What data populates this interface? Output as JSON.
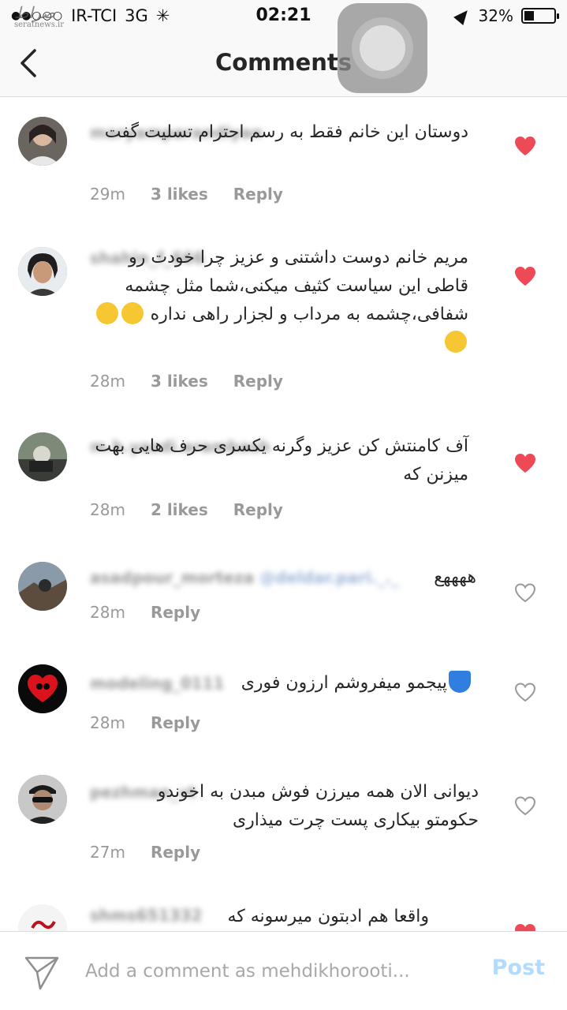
{
  "status_bar": {
    "carrier": "IR-TCI",
    "network": "3G",
    "time": "02:21",
    "battery": "32%",
    "battery_level": 0.32
  },
  "watermark": {
    "logo": "صراط",
    "site": "seratnews.ir"
  },
  "nav": {
    "title": "Comments"
  },
  "comments": [
    {
      "username": "maryamparandiyan",
      "text": "دوستان این خانم فقط به رسم احترام تسلیت گفت",
      "time": "29m",
      "likes": "3 likes",
      "reply": "Reply",
      "liked": true
    },
    {
      "username": "shahin_f_666",
      "text": "مریم خانم دوست داشتنی و عزیز چرا خودت رو قاطی این سیاست کثیف میکنی،شما مثل چشمه شفافی،چشمه به مرداب و لجزار راهی نداره",
      "time": "28m",
      "likes": "3 likes",
      "reply": "Reply",
      "liked": true
    },
    {
      "username": "m.h.yazdi.arambash",
      "text": "آف کامنتش کن عزیز وگرنه یکسری حرف هایی بهت میزنن که",
      "time": "28m",
      "likes": "2 likes",
      "reply": "Reply",
      "liked": true
    },
    {
      "username": "asadpour_morteza",
      "mention": "@deldar.pari._._",
      "text": "ههههع",
      "time": "28m",
      "reply": "Reply",
      "liked": false
    },
    {
      "username": "modeling_0111",
      "text": "پیجمو میفروشم ارزون فوری",
      "time": "28m",
      "reply": "Reply",
      "liked": false
    },
    {
      "username": "pezhman_vt",
      "text": "دیوانی الان همه میرزن فوش مبدن به اخوندو حکومتو بیکاری پست چرت میذاری",
      "time": "27m",
      "reply": "Reply",
      "liked": false
    },
    {
      "username": "shms651332",
      "text": "واقعا هم ادبتون میرسونه که",
      "liked": true
    }
  ],
  "input": {
    "placeholder": "Add a comment as mehdikhorooti...",
    "post_label": "Post"
  },
  "colors": {
    "heart_liked": "#ed4956",
    "heart_outline": "#999999",
    "post_disabled": "#b3dbff"
  }
}
